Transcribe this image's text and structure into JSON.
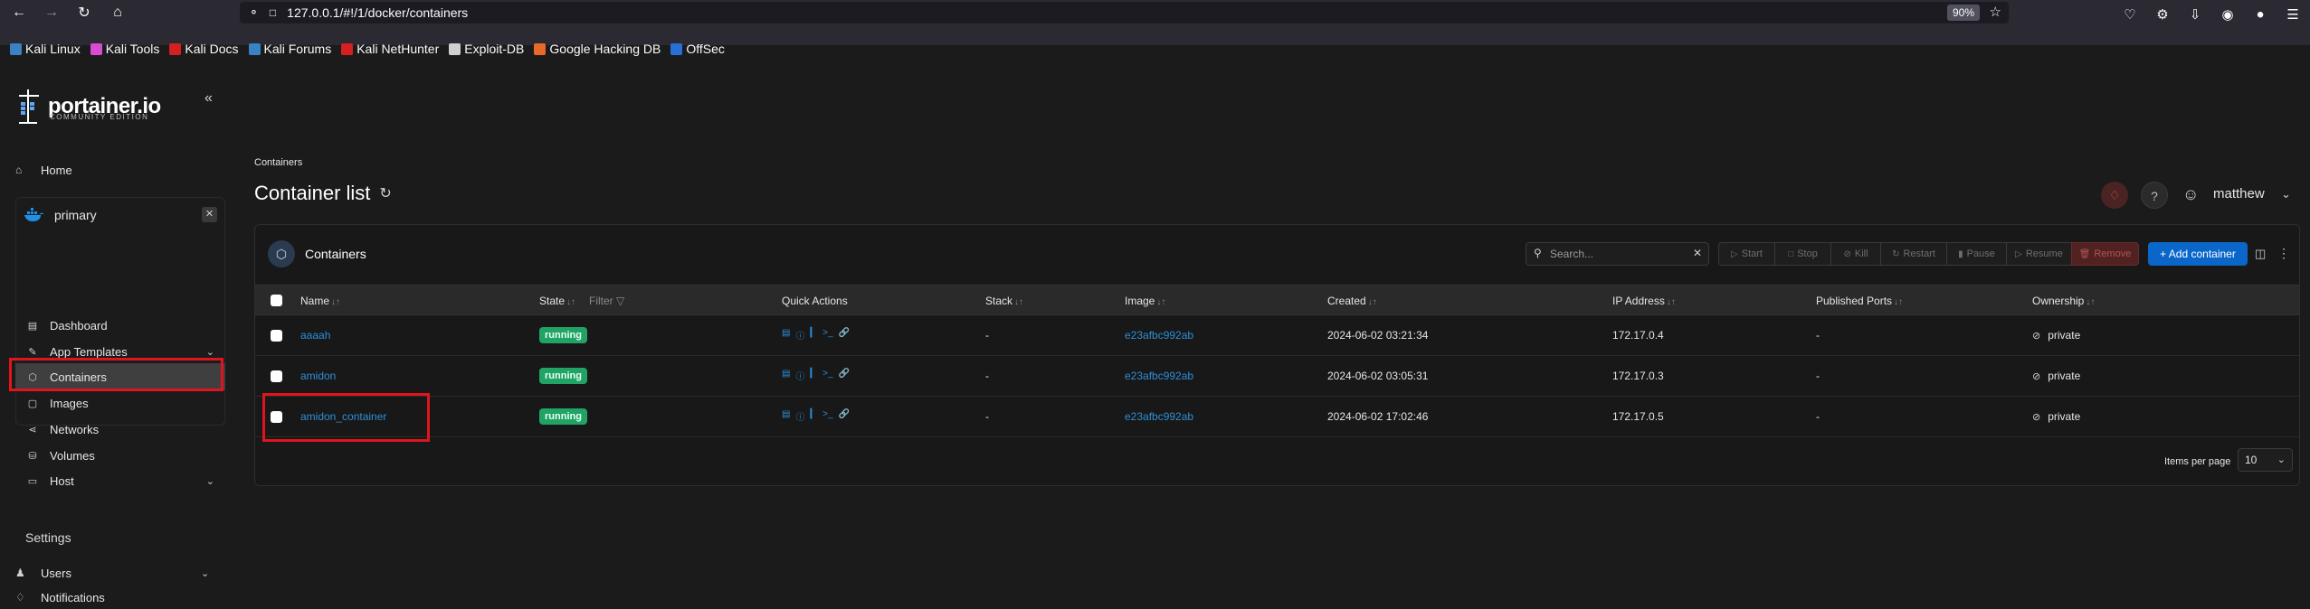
{
  "browser": {
    "url": "127.0.0.1/#!/1/docker/containers",
    "zoom": "90%",
    "bookmarks": [
      {
        "label": "Kali Linux",
        "color": "#3b82c4"
      },
      {
        "label": "Kali Tools",
        "color": "#d94bd0"
      },
      {
        "label": "Kali Docs",
        "color": "#d42020"
      },
      {
        "label": "Kali Forums",
        "color": "#3b82c4"
      },
      {
        "label": "Kali NetHunter",
        "color": "#d42020"
      },
      {
        "label": "Exploit-DB",
        "color": "#d0d0d0"
      },
      {
        "label": "Google Hacking DB",
        "color": "#e86a2b"
      },
      {
        "label": "OffSec",
        "color": "#2a6fd6"
      }
    ]
  },
  "sidebar": {
    "logo_text": "portainer.io",
    "logo_sub": "COMMUNITY EDITION",
    "home": "Home",
    "env_name": "primary",
    "env_items": [
      {
        "label": "Dashboard",
        "icon": "dashboard-icon"
      },
      {
        "label": "App Templates",
        "icon": "templates-icon"
      },
      {
        "label": "Containers",
        "icon": "containers-icon"
      },
      {
        "label": "Images",
        "icon": "images-icon"
      },
      {
        "label": "Networks",
        "icon": "networks-icon"
      },
      {
        "label": "Volumes",
        "icon": "volumes-icon"
      },
      {
        "label": "Host",
        "icon": "host-icon"
      }
    ],
    "settings_label": "Settings",
    "settings_items": [
      {
        "label": "Users",
        "icon": "users-icon"
      },
      {
        "label": "Notifications",
        "icon": "bell-icon"
      }
    ]
  },
  "header": {
    "breadcrumb": "Containers",
    "title": "Container list",
    "username": "matthew"
  },
  "card": {
    "title": "Containers",
    "search_placeholder": "Search...",
    "buttons": {
      "start": "Start",
      "stop": "Stop",
      "kill": "Kill",
      "restart": "Restart",
      "pause": "Pause",
      "resume": "Resume",
      "remove": "Remove",
      "add": "+ Add container"
    },
    "columns": {
      "name": "Name",
      "state": "State",
      "filter": "Filter",
      "quick_actions": "Quick Actions",
      "stack": "Stack",
      "image": "Image",
      "created": "Created",
      "ip": "IP Address",
      "ports": "Published Ports",
      "ownership": "Ownership"
    },
    "rows": [
      {
        "name": "aaaah",
        "state": "running",
        "stack": "-",
        "image": "e23afbc992ab",
        "created": "2024-06-02 03:21:34",
        "ip": "172.17.0.4",
        "ports": "-",
        "ownership": "private"
      },
      {
        "name": "amidon",
        "state": "running",
        "stack": "-",
        "image": "e23afbc992ab",
        "created": "2024-06-02 03:05:31",
        "ip": "172.17.0.3",
        "ports": "-",
        "ownership": "private"
      },
      {
        "name": "amidon_container",
        "state": "running",
        "stack": "-",
        "image": "e23afbc992ab",
        "created": "2024-06-02 17:02:46",
        "ip": "172.17.0.5",
        "ports": "-",
        "ownership": "private"
      }
    ],
    "items_per_page_label": "Items per page",
    "items_per_page_value": "10"
  }
}
